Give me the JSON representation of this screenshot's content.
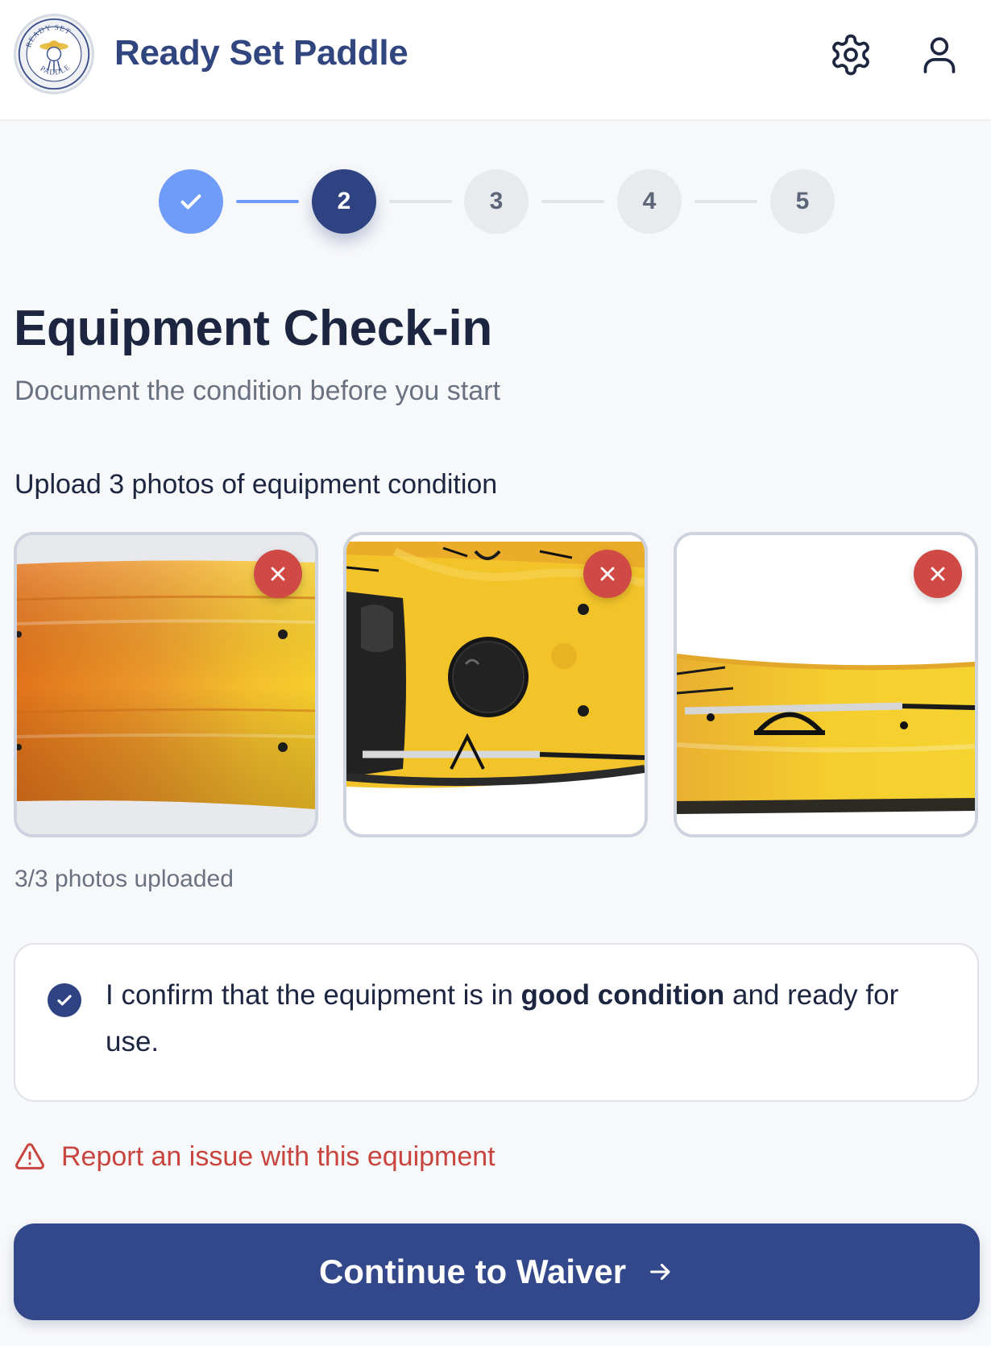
{
  "app": {
    "brand": "Ready Set Paddle",
    "logo_text": "READY SET PADDLE"
  },
  "header": {
    "icons": [
      "gear-icon",
      "user-icon"
    ]
  },
  "stepper": {
    "current": 2,
    "steps": [
      {
        "label": "",
        "state": "done"
      },
      {
        "label": "2",
        "state": "active"
      },
      {
        "label": "3",
        "state": "todo"
      },
      {
        "label": "4",
        "state": "todo"
      },
      {
        "label": "5",
        "state": "todo"
      }
    ]
  },
  "page": {
    "title": "Equipment Check-in",
    "subtitle": "Document the condition before you start"
  },
  "upload": {
    "label": "Upload 3 photos of equipment condition",
    "count_text": "3/3 photos uploaded",
    "photos": [
      {
        "subject": "kayak hull close-up"
      },
      {
        "subject": "kayak cockpit top view"
      },
      {
        "subject": "kayak side view"
      }
    ]
  },
  "confirm": {
    "checked": true,
    "text_before": "I confirm that the equipment is in ",
    "text_bold": "good condition",
    "text_after": " and ready for use."
  },
  "report": {
    "label": "Report an issue with this equipment"
  },
  "cta": {
    "label": "Continue to Waiver"
  },
  "colors": {
    "brand": "#31457f",
    "primary": "#33488a",
    "step_done": "#6f9cf8",
    "danger": "#cf4a44"
  }
}
